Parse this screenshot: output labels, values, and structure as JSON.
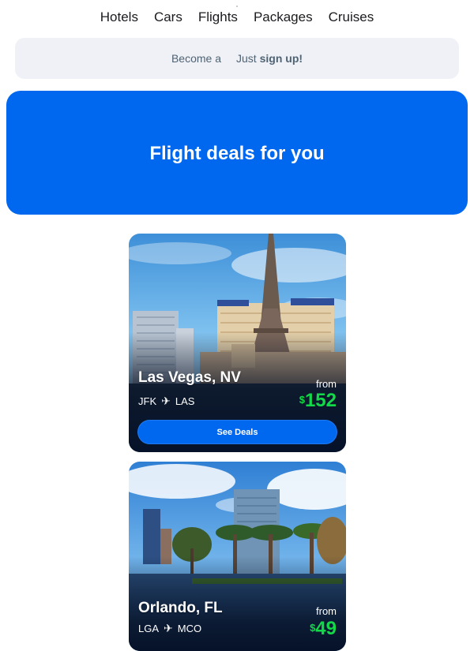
{
  "nav": {
    "items": [
      "Hotels",
      "Cars",
      "Flights",
      "Packages",
      "Cruises"
    ]
  },
  "banner": {
    "prefix": "Become a",
    "middle": "Just",
    "cta": "sign up!"
  },
  "hero": {
    "title": "Flight deals for you"
  },
  "deals": [
    {
      "city": "Las Vegas, NV",
      "origin": "JFK",
      "destination": "LAS",
      "from_label": "from",
      "currency": "$",
      "price": "152",
      "button_label": "See Deals"
    },
    {
      "city": "Orlando, FL",
      "origin": "LGA",
      "destination": "MCO",
      "from_label": "from",
      "currency": "$",
      "price": "49"
    }
  ],
  "colors": {
    "brand_blue": "#0068ef",
    "price_green": "#13d84a",
    "banner_bg": "#eff1f6"
  },
  "icons": {
    "route_separator": "airplane-icon"
  }
}
